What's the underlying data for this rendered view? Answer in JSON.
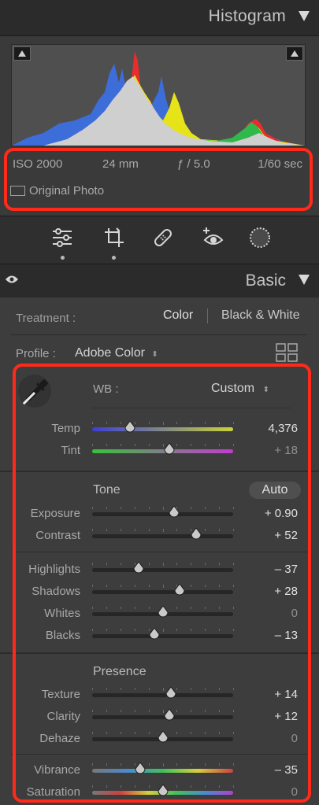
{
  "histogram": {
    "title": "Histogram",
    "exif": {
      "iso": "ISO 2000",
      "focal": "24 mm",
      "aperture": "ƒ / 5.0",
      "shutter": "1/60 sec"
    },
    "original_photo_label": "Original Photo"
  },
  "basic": {
    "title": "Basic",
    "treatment_label": "Treatment :",
    "treatment_color": "Color",
    "treatment_bw": "Black & White",
    "profile_label": "Profile :",
    "profile_value": "Adobe Color",
    "wb_label": "WB :",
    "wb_value": "Custom",
    "tone_title": "Tone",
    "auto_label": "Auto",
    "presence_title": "Presence",
    "sliders": {
      "temp": {
        "label": "Temp",
        "value": "4,376",
        "position": 0.27
      },
      "tint": {
        "label": "Tint",
        "value": "+ 18",
        "position": 0.55
      },
      "exposure": {
        "label": "Exposure",
        "value": "+ 0.90",
        "position": 0.58
      },
      "contrast": {
        "label": "Contrast",
        "value": "+ 52",
        "position": 0.74
      },
      "highlights": {
        "label": "Highlights",
        "value": "– 37",
        "position": 0.33
      },
      "shadows": {
        "label": "Shadows",
        "value": "+ 28",
        "position": 0.62
      },
      "whites": {
        "label": "Whites",
        "value": "0",
        "position": 0.5
      },
      "blacks": {
        "label": "Blacks",
        "value": "– 13",
        "position": 0.44
      },
      "texture": {
        "label": "Texture",
        "value": "+ 14",
        "position": 0.56
      },
      "clarity": {
        "label": "Clarity",
        "value": "+ 12",
        "position": 0.55
      },
      "dehaze": {
        "label": "Dehaze",
        "value": "0",
        "position": 0.5
      },
      "vibrance": {
        "label": "Vibrance",
        "value": "– 35",
        "position": 0.34
      },
      "saturation": {
        "label": "Saturation",
        "value": "0",
        "position": 0.5
      }
    }
  },
  "colors": {
    "highlight_border": "#ff2a1a",
    "panel_bg": "#3d3d3d",
    "accent_text": "#e0e0e0"
  },
  "icons": [
    "triangle-down-icon",
    "clip-warning-icon",
    "edit-sliders-icon",
    "crop-icon",
    "healing-icon",
    "red-eye-icon",
    "masking-icon",
    "eye-icon",
    "eyedropper-icon",
    "grid-icon"
  ]
}
